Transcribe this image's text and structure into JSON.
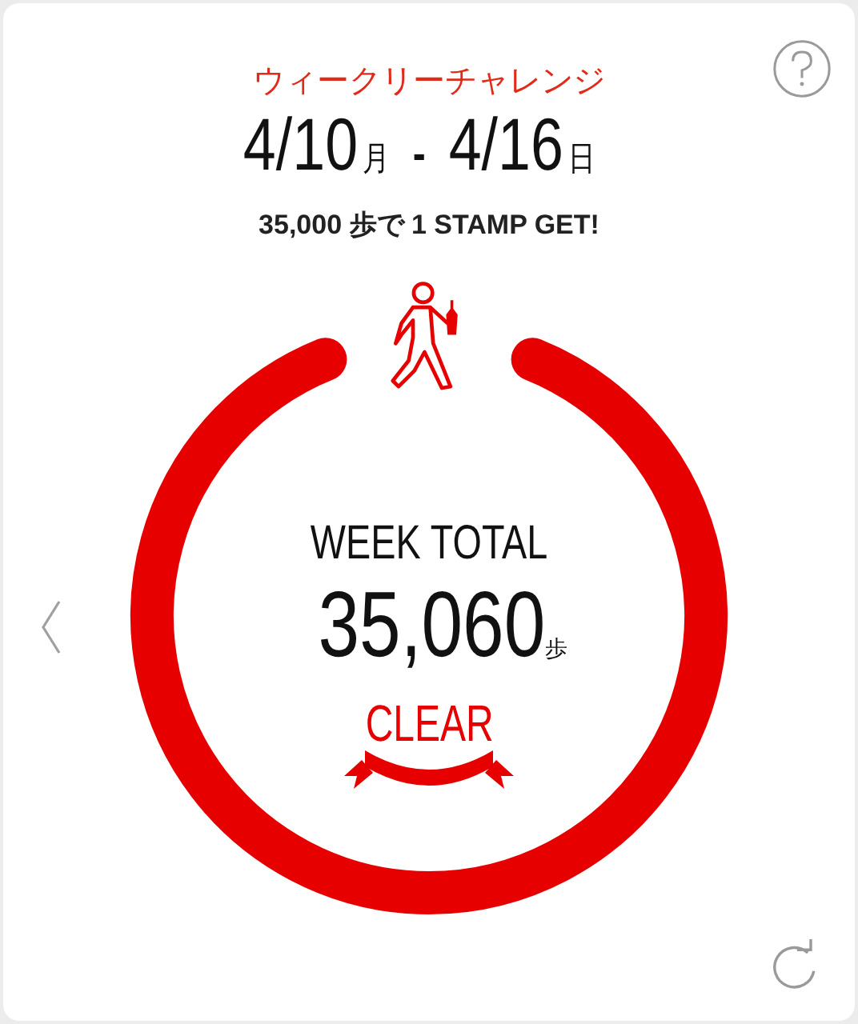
{
  "title": "ウィークリーチャレンジ",
  "date_range": {
    "start": "4/10",
    "start_day": "月",
    "separator": "-",
    "end": "4/16",
    "end_day": "日"
  },
  "goal": "35,000 歩で 1 STAMP GET!",
  "progress": {
    "label": "WEEK TOTAL",
    "value": "35,060",
    "unit": "歩",
    "badge": "CLEAR"
  }
}
